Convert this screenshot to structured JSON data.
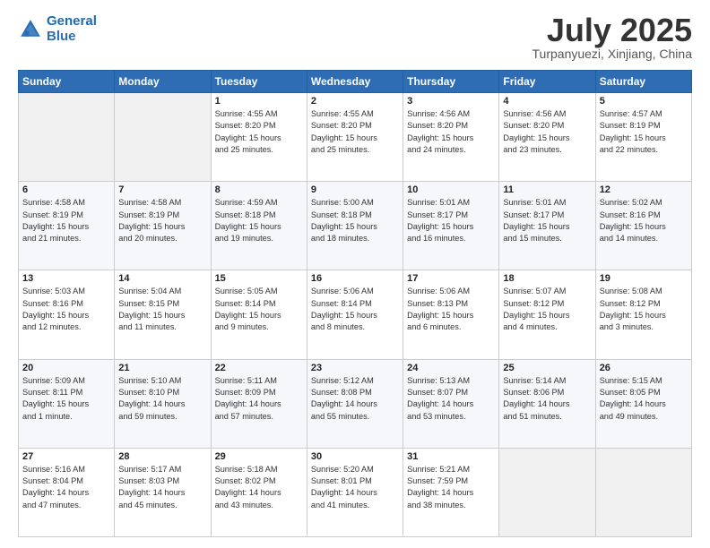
{
  "logo": {
    "line1": "General",
    "line2": "Blue"
  },
  "title": "July 2025",
  "location": "Turpanyuezi, Xinjiang, China",
  "days_of_week": [
    "Sunday",
    "Monday",
    "Tuesday",
    "Wednesday",
    "Thursday",
    "Friday",
    "Saturday"
  ],
  "weeks": [
    [
      {
        "day": "",
        "info": ""
      },
      {
        "day": "",
        "info": ""
      },
      {
        "day": "1",
        "info": "Sunrise: 4:55 AM\nSunset: 8:20 PM\nDaylight: 15 hours\nand 25 minutes."
      },
      {
        "day": "2",
        "info": "Sunrise: 4:55 AM\nSunset: 8:20 PM\nDaylight: 15 hours\nand 25 minutes."
      },
      {
        "day": "3",
        "info": "Sunrise: 4:56 AM\nSunset: 8:20 PM\nDaylight: 15 hours\nand 24 minutes."
      },
      {
        "day": "4",
        "info": "Sunrise: 4:56 AM\nSunset: 8:20 PM\nDaylight: 15 hours\nand 23 minutes."
      },
      {
        "day": "5",
        "info": "Sunrise: 4:57 AM\nSunset: 8:19 PM\nDaylight: 15 hours\nand 22 minutes."
      }
    ],
    [
      {
        "day": "6",
        "info": "Sunrise: 4:58 AM\nSunset: 8:19 PM\nDaylight: 15 hours\nand 21 minutes."
      },
      {
        "day": "7",
        "info": "Sunrise: 4:58 AM\nSunset: 8:19 PM\nDaylight: 15 hours\nand 20 minutes."
      },
      {
        "day": "8",
        "info": "Sunrise: 4:59 AM\nSunset: 8:18 PM\nDaylight: 15 hours\nand 19 minutes."
      },
      {
        "day": "9",
        "info": "Sunrise: 5:00 AM\nSunset: 8:18 PM\nDaylight: 15 hours\nand 18 minutes."
      },
      {
        "day": "10",
        "info": "Sunrise: 5:01 AM\nSunset: 8:17 PM\nDaylight: 15 hours\nand 16 minutes."
      },
      {
        "day": "11",
        "info": "Sunrise: 5:01 AM\nSunset: 8:17 PM\nDaylight: 15 hours\nand 15 minutes."
      },
      {
        "day": "12",
        "info": "Sunrise: 5:02 AM\nSunset: 8:16 PM\nDaylight: 15 hours\nand 14 minutes."
      }
    ],
    [
      {
        "day": "13",
        "info": "Sunrise: 5:03 AM\nSunset: 8:16 PM\nDaylight: 15 hours\nand 12 minutes."
      },
      {
        "day": "14",
        "info": "Sunrise: 5:04 AM\nSunset: 8:15 PM\nDaylight: 15 hours\nand 11 minutes."
      },
      {
        "day": "15",
        "info": "Sunrise: 5:05 AM\nSunset: 8:14 PM\nDaylight: 15 hours\nand 9 minutes."
      },
      {
        "day": "16",
        "info": "Sunrise: 5:06 AM\nSunset: 8:14 PM\nDaylight: 15 hours\nand 8 minutes."
      },
      {
        "day": "17",
        "info": "Sunrise: 5:06 AM\nSunset: 8:13 PM\nDaylight: 15 hours\nand 6 minutes."
      },
      {
        "day": "18",
        "info": "Sunrise: 5:07 AM\nSunset: 8:12 PM\nDaylight: 15 hours\nand 4 minutes."
      },
      {
        "day": "19",
        "info": "Sunrise: 5:08 AM\nSunset: 8:12 PM\nDaylight: 15 hours\nand 3 minutes."
      }
    ],
    [
      {
        "day": "20",
        "info": "Sunrise: 5:09 AM\nSunset: 8:11 PM\nDaylight: 15 hours\nand 1 minute."
      },
      {
        "day": "21",
        "info": "Sunrise: 5:10 AM\nSunset: 8:10 PM\nDaylight: 14 hours\nand 59 minutes."
      },
      {
        "day": "22",
        "info": "Sunrise: 5:11 AM\nSunset: 8:09 PM\nDaylight: 14 hours\nand 57 minutes."
      },
      {
        "day": "23",
        "info": "Sunrise: 5:12 AM\nSunset: 8:08 PM\nDaylight: 14 hours\nand 55 minutes."
      },
      {
        "day": "24",
        "info": "Sunrise: 5:13 AM\nSunset: 8:07 PM\nDaylight: 14 hours\nand 53 minutes."
      },
      {
        "day": "25",
        "info": "Sunrise: 5:14 AM\nSunset: 8:06 PM\nDaylight: 14 hours\nand 51 minutes."
      },
      {
        "day": "26",
        "info": "Sunrise: 5:15 AM\nSunset: 8:05 PM\nDaylight: 14 hours\nand 49 minutes."
      }
    ],
    [
      {
        "day": "27",
        "info": "Sunrise: 5:16 AM\nSunset: 8:04 PM\nDaylight: 14 hours\nand 47 minutes."
      },
      {
        "day": "28",
        "info": "Sunrise: 5:17 AM\nSunset: 8:03 PM\nDaylight: 14 hours\nand 45 minutes."
      },
      {
        "day": "29",
        "info": "Sunrise: 5:18 AM\nSunset: 8:02 PM\nDaylight: 14 hours\nand 43 minutes."
      },
      {
        "day": "30",
        "info": "Sunrise: 5:20 AM\nSunset: 8:01 PM\nDaylight: 14 hours\nand 41 minutes."
      },
      {
        "day": "31",
        "info": "Sunrise: 5:21 AM\nSunset: 7:59 PM\nDaylight: 14 hours\nand 38 minutes."
      },
      {
        "day": "",
        "info": ""
      },
      {
        "day": "",
        "info": ""
      }
    ]
  ]
}
